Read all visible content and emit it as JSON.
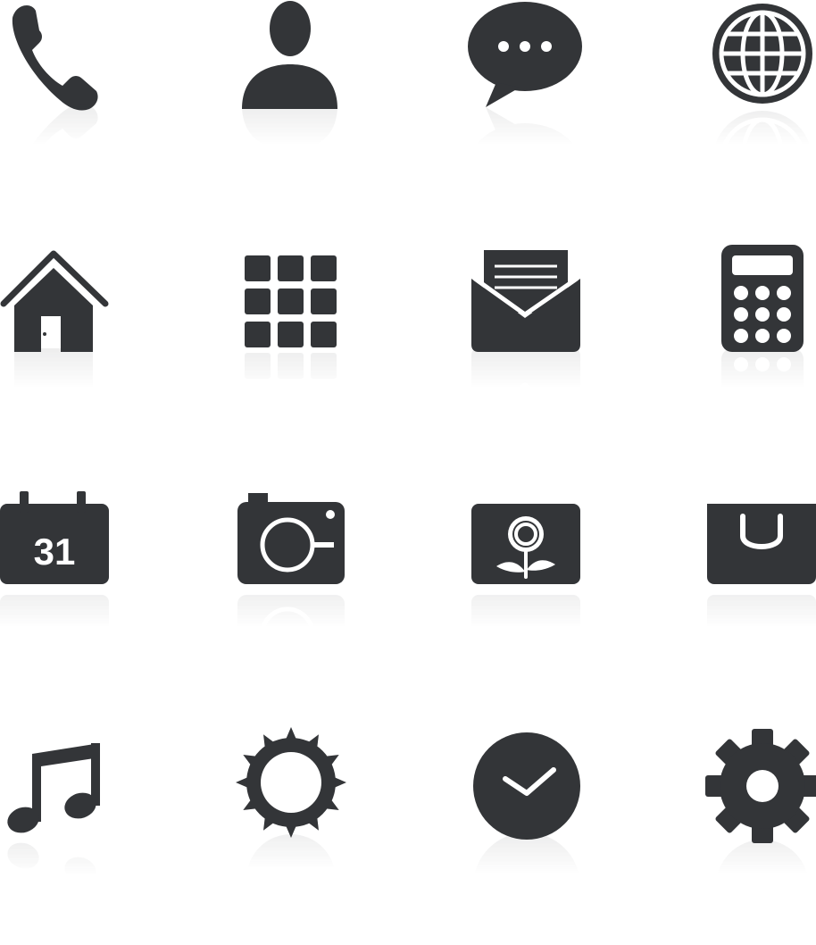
{
  "colors": {
    "icon": "#333538",
    "background": "#ffffff"
  },
  "icons": [
    {
      "name": "phone-icon"
    },
    {
      "name": "user-icon"
    },
    {
      "name": "chat-bubble-icon"
    },
    {
      "name": "globe-icon"
    },
    {
      "name": "home-icon"
    },
    {
      "name": "app-grid-icon"
    },
    {
      "name": "open-envelope-icon"
    },
    {
      "name": "calculator-icon"
    },
    {
      "name": "calendar-icon",
      "text": "31"
    },
    {
      "name": "camera-icon"
    },
    {
      "name": "photo-gallery-icon"
    },
    {
      "name": "shopping-bag-icon"
    },
    {
      "name": "music-note-icon"
    },
    {
      "name": "sun-icon"
    },
    {
      "name": "clock-icon"
    },
    {
      "name": "settings-gear-icon"
    }
  ]
}
